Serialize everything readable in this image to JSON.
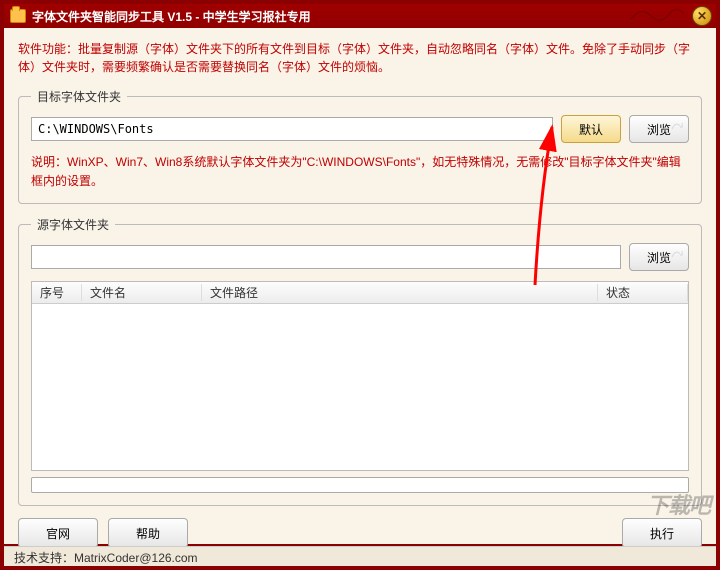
{
  "window": {
    "title": "字体文件夹智能同步工具 V1.5 - 中学生学习报社专用"
  },
  "description": "软件功能：批量复制源（字体）文件夹下的所有文件到目标（字体）文件夹，自动忽略同名（字体）文件。免除了手动同步（字体）文件夹时，需要频繁确认是否需要替换同名（字体）文件的烦恼。",
  "target_group": {
    "legend": "目标字体文件夹",
    "path_value": "C:\\WINDOWS\\Fonts",
    "default_btn": "默认",
    "browse_btn": "浏览",
    "note": "说明：WinXP、Win7、Win8系统默认字体文件夹为\"C:\\WINDOWS\\Fonts\"，如无特殊情况，无需修改\"目标字体文件夹\"编辑框内的设置。"
  },
  "source_group": {
    "legend": "源字体文件夹",
    "path_value": "",
    "browse_btn": "浏览",
    "columns": {
      "seq": "序号",
      "name": "文件名",
      "path": "文件路径",
      "status": "状态"
    }
  },
  "buttons": {
    "website": "官网",
    "help": "帮助",
    "run": "执行"
  },
  "footer": {
    "support": "技术支持：MatrixCoder@126.com"
  },
  "watermark": "下载吧"
}
